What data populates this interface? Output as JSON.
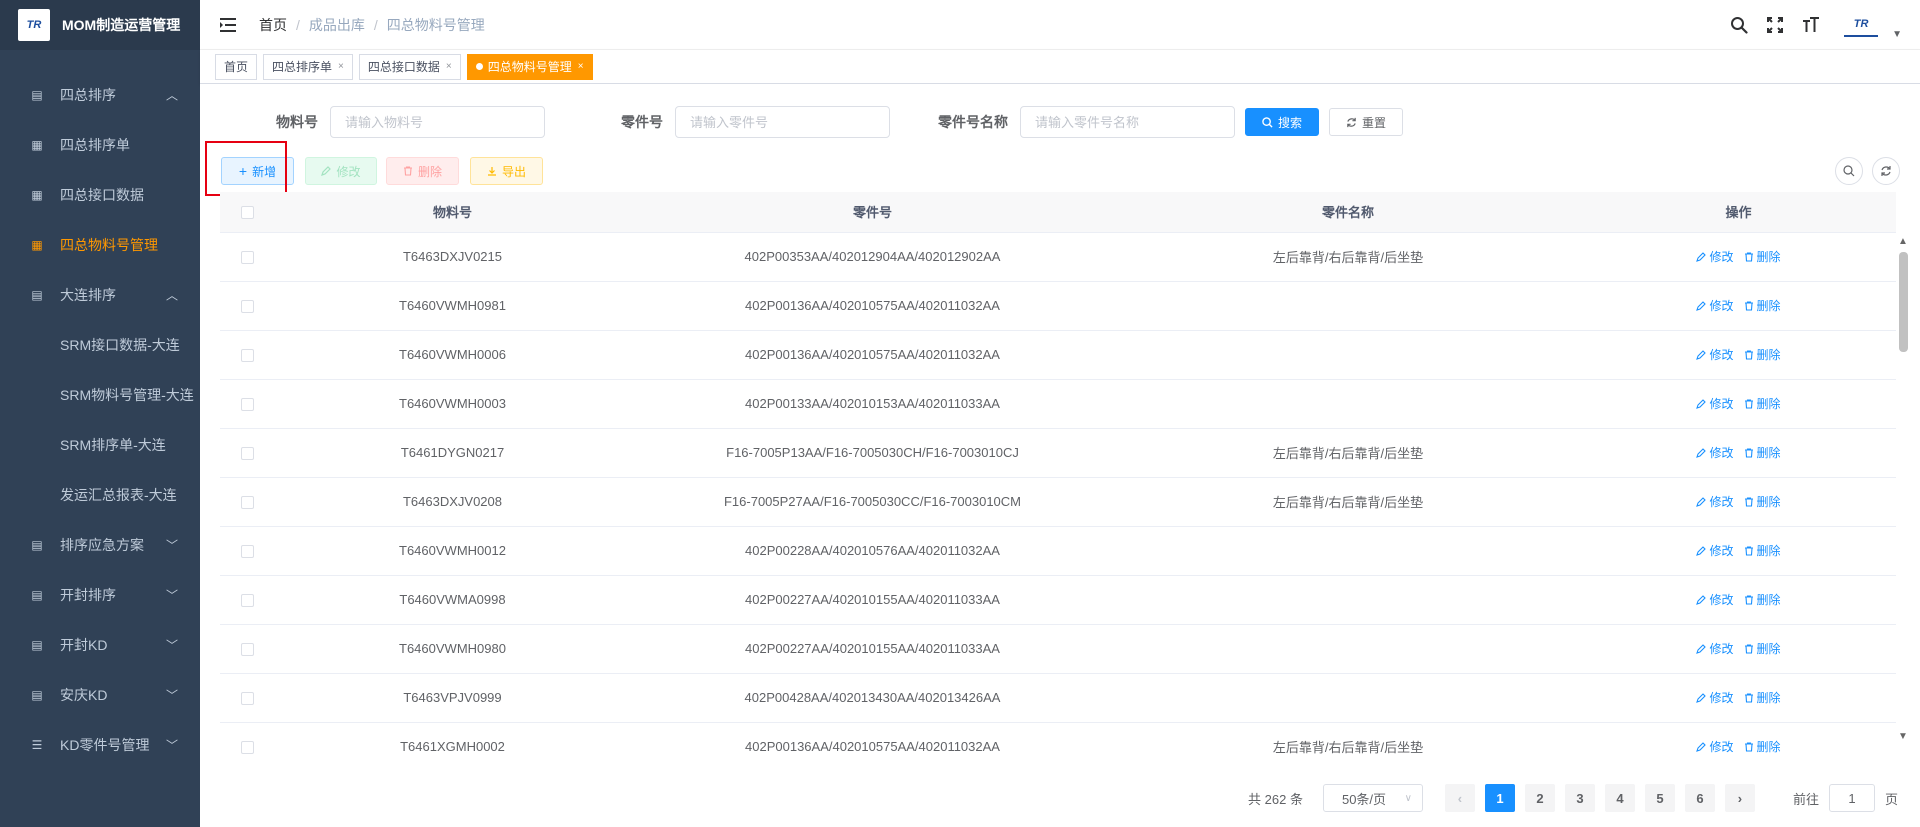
{
  "app": {
    "title": "MOM制造运营管理",
    "logo_text": "TR"
  },
  "sidebar": {
    "items": [
      {
        "label": "四总排序",
        "kind": "group",
        "expanded": true
      },
      {
        "label": "四总排序单",
        "kind": "sub"
      },
      {
        "label": "四总接口数据",
        "kind": "sub"
      },
      {
        "label": "四总物料号管理",
        "kind": "sub",
        "active": true
      },
      {
        "label": "大连排序",
        "kind": "group",
        "expanded": true
      },
      {
        "label": "SRM接口数据-大连",
        "kind": "sub"
      },
      {
        "label": "SRM物料号管理-大连",
        "kind": "sub"
      },
      {
        "label": "SRM排序单-大连",
        "kind": "sub"
      },
      {
        "label": "发运汇总报表-大连",
        "kind": "sub"
      },
      {
        "label": "排序应急方案",
        "kind": "group"
      },
      {
        "label": "开封排序",
        "kind": "group"
      },
      {
        "label": "开封KD",
        "kind": "group"
      },
      {
        "label": "安庆KD",
        "kind": "group"
      },
      {
        "label": "KD零件号管理",
        "kind": "group"
      }
    ]
  },
  "breadcrumb": [
    "首页",
    "成品出库",
    "四总物料号管理"
  ],
  "tags": [
    {
      "label": "首页",
      "closable": false
    },
    {
      "label": "四总排序单",
      "closable": true
    },
    {
      "label": "四总接口数据",
      "closable": true
    },
    {
      "label": "四总物料号管理",
      "closable": true,
      "active": true
    }
  ],
  "search": {
    "material_label": "物料号",
    "material_placeholder": "请输入物料号",
    "part_label": "零件号",
    "part_placeholder": "请输入零件号",
    "partname_label": "零件号名称",
    "partname_placeholder": "请输入零件号名称",
    "search_btn": "搜索",
    "reset_btn": "重置"
  },
  "toolbar": {
    "add": "新增",
    "edit": "修改",
    "delete": "删除",
    "export": "导出"
  },
  "table": {
    "columns": [
      "物料号",
      "零件号",
      "零件名称",
      "操作"
    ],
    "edit_label": "修改",
    "delete_label": "删除",
    "rows": [
      {
        "material": "T6463DXJV0215",
        "part": "402P00353AA/402012904AA/402012902AA",
        "name": "左后靠背/右后靠背/后坐垫"
      },
      {
        "material": "T6460VWMH0981",
        "part": "402P00136AA/402010575AA/402011032AA",
        "name": ""
      },
      {
        "material": "T6460VWMH0006",
        "part": "402P00136AA/402010575AA/402011032AA",
        "name": ""
      },
      {
        "material": "T6460VWMH0003",
        "part": "402P00133AA/402010153AA/402011033AA",
        "name": ""
      },
      {
        "material": "T6461DYGN0217",
        "part": "F16-7005P13AA/F16-7005030CH/F16-7003010CJ",
        "name": "左后靠背/右后靠背/后坐垫"
      },
      {
        "material": "T6463DXJV0208",
        "part": "F16-7005P27AA/F16-7005030CC/F16-7003010CM",
        "name": "左后靠背/右后靠背/后坐垫"
      },
      {
        "material": "T6460VWMH0012",
        "part": "402P00228AA/402010576AA/402011032AA",
        "name": ""
      },
      {
        "material": "T6460VWMA0998",
        "part": "402P00227AA/402010155AA/402011033AA",
        "name": ""
      },
      {
        "material": "T6460VWMH0980",
        "part": "402P00227AA/402010155AA/402011033AA",
        "name": ""
      },
      {
        "material": "T6463VPJV0999",
        "part": "402P00428AA/402013430AA/402013426AA",
        "name": ""
      },
      {
        "material": "T6461XGMH0002",
        "part": "402P00136AA/402010575AA/402011032AA",
        "name": "左后靠背/右后靠背/后坐垫"
      }
    ]
  },
  "pagination": {
    "total_text": "共 262 条",
    "page_size": "50条/页",
    "pages": [
      "1",
      "2",
      "3",
      "4",
      "5",
      "6"
    ],
    "current": "1",
    "goto_label": "前往",
    "goto_value": "1",
    "page_suffix": "页"
  },
  "colors": {
    "sidebar_bg": "#304156",
    "accent": "#ff9800",
    "primary": "#1890ff",
    "highlight": "#e60012"
  }
}
